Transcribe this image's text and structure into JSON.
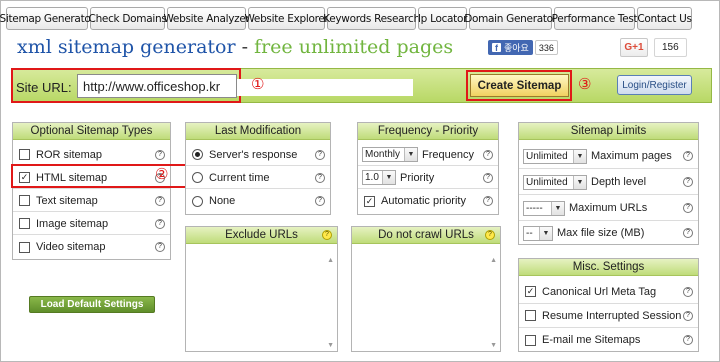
{
  "tabs": [
    "Sitemap Generator",
    "Check Domains",
    "Website Analyzer",
    "Website Explorer",
    "Keywords Research",
    "Ip Locator",
    "Domain Generator",
    "Performance Test",
    "Contact Us"
  ],
  "title": {
    "part1": "xml sitemap generator",
    "dash": " - ",
    "part2": "free unlimited pages"
  },
  "facebook": {
    "label": "좋아요",
    "icon": "f",
    "count": "336"
  },
  "gplus": {
    "label": "G+1",
    "count": "156"
  },
  "url_bar": {
    "label": "Site URL:",
    "value": "http://www.officeshop.kr",
    "create_label": "Create Sitemap",
    "login_label": "Login/Register"
  },
  "markers": {
    "one": "①",
    "two": "②",
    "three": "③"
  },
  "help_glyph": "?",
  "sitemap_types": {
    "title": "Optional Sitemap Types",
    "items": [
      {
        "label": "ROR sitemap",
        "checked": false
      },
      {
        "label": "HTML sitemap",
        "checked": true
      },
      {
        "label": "Text sitemap",
        "checked": false
      },
      {
        "label": "Image sitemap",
        "checked": false
      },
      {
        "label": "Video sitemap",
        "checked": false
      }
    ]
  },
  "last_modification": {
    "title": "Last Modification",
    "options": [
      {
        "label": "Server's response",
        "selected": true
      },
      {
        "label": "Current time",
        "selected": false
      },
      {
        "label": "None",
        "selected": false
      }
    ]
  },
  "frequency": {
    "title": "Frequency - Priority",
    "freq_value": "Monthly",
    "freq_label": "Frequency",
    "priority_value": "1.0",
    "priority_label": "Priority",
    "auto_label": "Automatic priority",
    "auto_checked": true
  },
  "limits": {
    "title": "Sitemap Limits",
    "items": [
      {
        "value": "Unlimited",
        "label": "Maximum pages"
      },
      {
        "value": "Unlimited",
        "label": "Depth level"
      },
      {
        "value": "-----",
        "label": "Maximum URLs"
      },
      {
        "value": "--",
        "label": "Max file size (MB)"
      }
    ]
  },
  "exclude_urls": {
    "title": "Exclude URLs"
  },
  "no_crawl_urls": {
    "title": "Do not crawl URLs"
  },
  "misc": {
    "title": "Misc. Settings",
    "items": [
      {
        "label": "Canonical Url Meta Tag",
        "checked": true
      },
      {
        "label": "Resume Interrupted Session",
        "checked": false
      },
      {
        "label": "E-mail me Sitemaps",
        "checked": false
      }
    ]
  },
  "load_defaults_label": "Load Default Settings"
}
